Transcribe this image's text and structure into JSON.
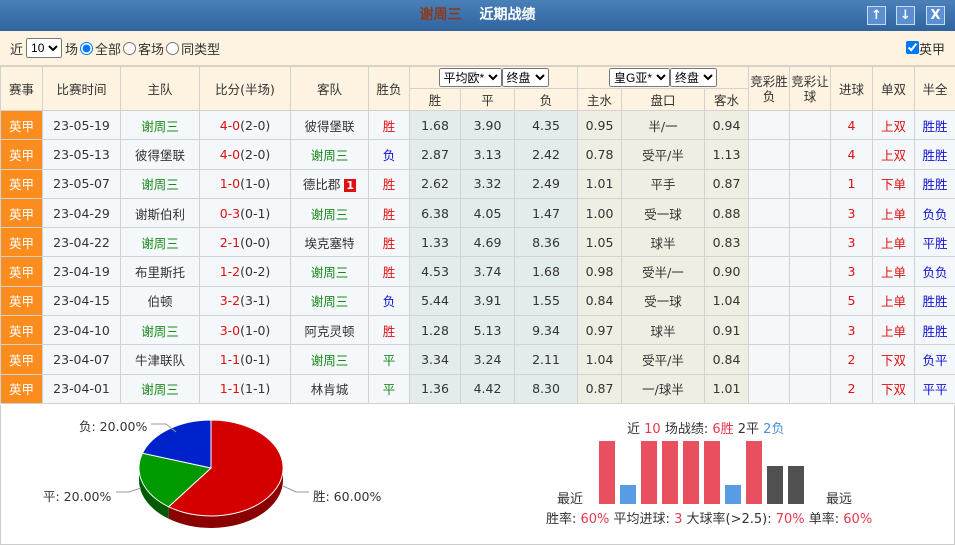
{
  "title": {
    "team": "谢周三",
    "text": "近期战绩"
  },
  "buttons": {
    "up": "↑",
    "down": "↓",
    "close": "X"
  },
  "filter": {
    "prefix": "近",
    "count": "10",
    "suffix": "场",
    "opt_all": "全部",
    "opt_away": "客场",
    "opt_same": "同类型",
    "league_check": "英甲"
  },
  "headers": {
    "league": "赛事",
    "date": "比赛时间",
    "home": "主队",
    "score": "比分(半场)",
    "away": "客队",
    "result": "胜负",
    "euro_company": "平均欧*",
    "euro_type": "终盘",
    "asia_company": "皇G亚*",
    "asia_type": "终盘",
    "jc_wl": "竞彩胜负",
    "jc_hc": "竞彩让球",
    "goals": "进球",
    "oe": "单双",
    "htft": "半全",
    "w": "胜",
    "d": "平",
    "l": "负",
    "hw": "主水",
    "line": "盘口",
    "aw": "客水"
  },
  "rows": [
    {
      "league": "英甲",
      "date": "23-05-19",
      "home": "谢周三",
      "hs": "4-0",
      "ht": "(2-0)",
      "away": "彼得堡联",
      "res": "胜",
      "w": "1.68",
      "d": "3.90",
      "l": "4.35",
      "hw": "0.95",
      "line": "半/一",
      "aw": "0.94",
      "goals": "4",
      "oe": "上双",
      "htft": "胜胜",
      "home_focus": true
    },
    {
      "league": "英甲",
      "date": "23-05-13",
      "home": "彼得堡联",
      "hs": "4-0",
      "ht": "(2-0)",
      "away": "谢周三",
      "res": "负",
      "w": "2.87",
      "d": "3.13",
      "l": "2.42",
      "hw": "0.78",
      "line": "受平/半",
      "aw": "1.13",
      "goals": "4",
      "oe": "上双",
      "htft": "胜胜",
      "home_focus": false
    },
    {
      "league": "英甲",
      "date": "23-05-07",
      "home": "谢周三",
      "hs": "1-0",
      "ht": "(1-0)",
      "away": "德比郡",
      "red": "1",
      "res": "胜",
      "w": "2.62",
      "d": "3.32",
      "l": "2.49",
      "hw": "1.01",
      "line": "平手",
      "aw": "0.87",
      "goals": "1",
      "oe": "下单",
      "htft": "胜胜",
      "home_focus": true
    },
    {
      "league": "英甲",
      "date": "23-04-29",
      "home": "谢斯伯利",
      "hs": "0-3",
      "ht": "(0-1)",
      "away": "谢周三",
      "res": "胜",
      "w": "6.38",
      "d": "4.05",
      "l": "1.47",
      "hw": "1.00",
      "line": "受一球",
      "aw": "0.88",
      "goals": "3",
      "oe": "上单",
      "htft": "负负",
      "home_focus": false
    },
    {
      "league": "英甲",
      "date": "23-04-22",
      "home": "谢周三",
      "hs": "2-1",
      "ht": "(0-0)",
      "away": "埃克塞特",
      "res": "胜",
      "w": "1.33",
      "d": "4.69",
      "l": "8.36",
      "hw": "1.05",
      "line": "球半",
      "aw": "0.83",
      "goals": "3",
      "oe": "上单",
      "htft": "平胜",
      "home_focus": true
    },
    {
      "league": "英甲",
      "date": "23-04-19",
      "home": "布里斯托",
      "hs": "1-2",
      "ht": "(0-2)",
      "away": "谢周三",
      "res": "胜",
      "w": "4.53",
      "d": "3.74",
      "l": "1.68",
      "hw": "0.98",
      "line": "受半/一",
      "aw": "0.90",
      "goals": "3",
      "oe": "上单",
      "htft": "负负",
      "home_focus": false
    },
    {
      "league": "英甲",
      "date": "23-04-15",
      "home": "伯顿",
      "hs": "3-2",
      "ht": "(3-1)",
      "away": "谢周三",
      "res": "负",
      "w": "5.44",
      "d": "3.91",
      "l": "1.55",
      "hw": "0.84",
      "line": "受一球",
      "aw": "1.04",
      "goals": "5",
      "oe": "上单",
      "htft": "胜胜",
      "home_focus": false
    },
    {
      "league": "英甲",
      "date": "23-04-10",
      "home": "谢周三",
      "hs": "3-0",
      "ht": "(1-0)",
      "away": "阿克灵顿",
      "res": "胜",
      "w": "1.28",
      "d": "5.13",
      "l": "9.34",
      "hw": "0.97",
      "line": "球半",
      "aw": "0.91",
      "goals": "3",
      "oe": "上单",
      "htft": "胜胜",
      "home_focus": true
    },
    {
      "league": "英甲",
      "date": "23-04-07",
      "home": "牛津联队",
      "hs": "1-1",
      "ht": "(0-1)",
      "away": "谢周三",
      "res": "平",
      "w": "3.34",
      "d": "3.24",
      "l": "2.11",
      "hw": "1.04",
      "line": "受平/半",
      "aw": "0.84",
      "goals": "2",
      "oe": "下双",
      "htft": "负平",
      "home_focus": false
    },
    {
      "league": "英甲",
      "date": "23-04-01",
      "home": "谢周三",
      "hs": "1-1",
      "ht": "(1-1)",
      "away": "林肯城",
      "res": "平",
      "w": "1.36",
      "d": "4.42",
      "l": "8.30",
      "hw": "0.87",
      "line": "一/球半",
      "aw": "1.01",
      "goals": "2",
      "oe": "下双",
      "htft": "平平",
      "home_focus": true
    }
  ],
  "pie": {
    "loss": "负: 20.00%",
    "draw": "平: 20.00%",
    "win": "胜: 60.00%",
    "values": {
      "win": 60,
      "draw": 20,
      "loss": 20
    },
    "colors": {
      "win": "#d40000",
      "draw": "#009900",
      "loss": "#0022cc"
    }
  },
  "summary": {
    "p1": "近 ",
    "n": "10",
    "p2": " 场战绩: ",
    "wins": "6胜",
    "draws": " 2平 ",
    "losses": "2负",
    "recent": "最近",
    "far": "最远",
    "s1": "胜率: ",
    "v1": "60%",
    "s2": " 平均进球: ",
    "v2": "3",
    "s3": " 大球率(>2.5): ",
    "v3": "70%",
    "s4": " 单率: ",
    "v4": "60%",
    "bars": [
      "W",
      "L",
      "W",
      "W",
      "W",
      "W",
      "L",
      "W",
      "D",
      "D"
    ]
  }
}
